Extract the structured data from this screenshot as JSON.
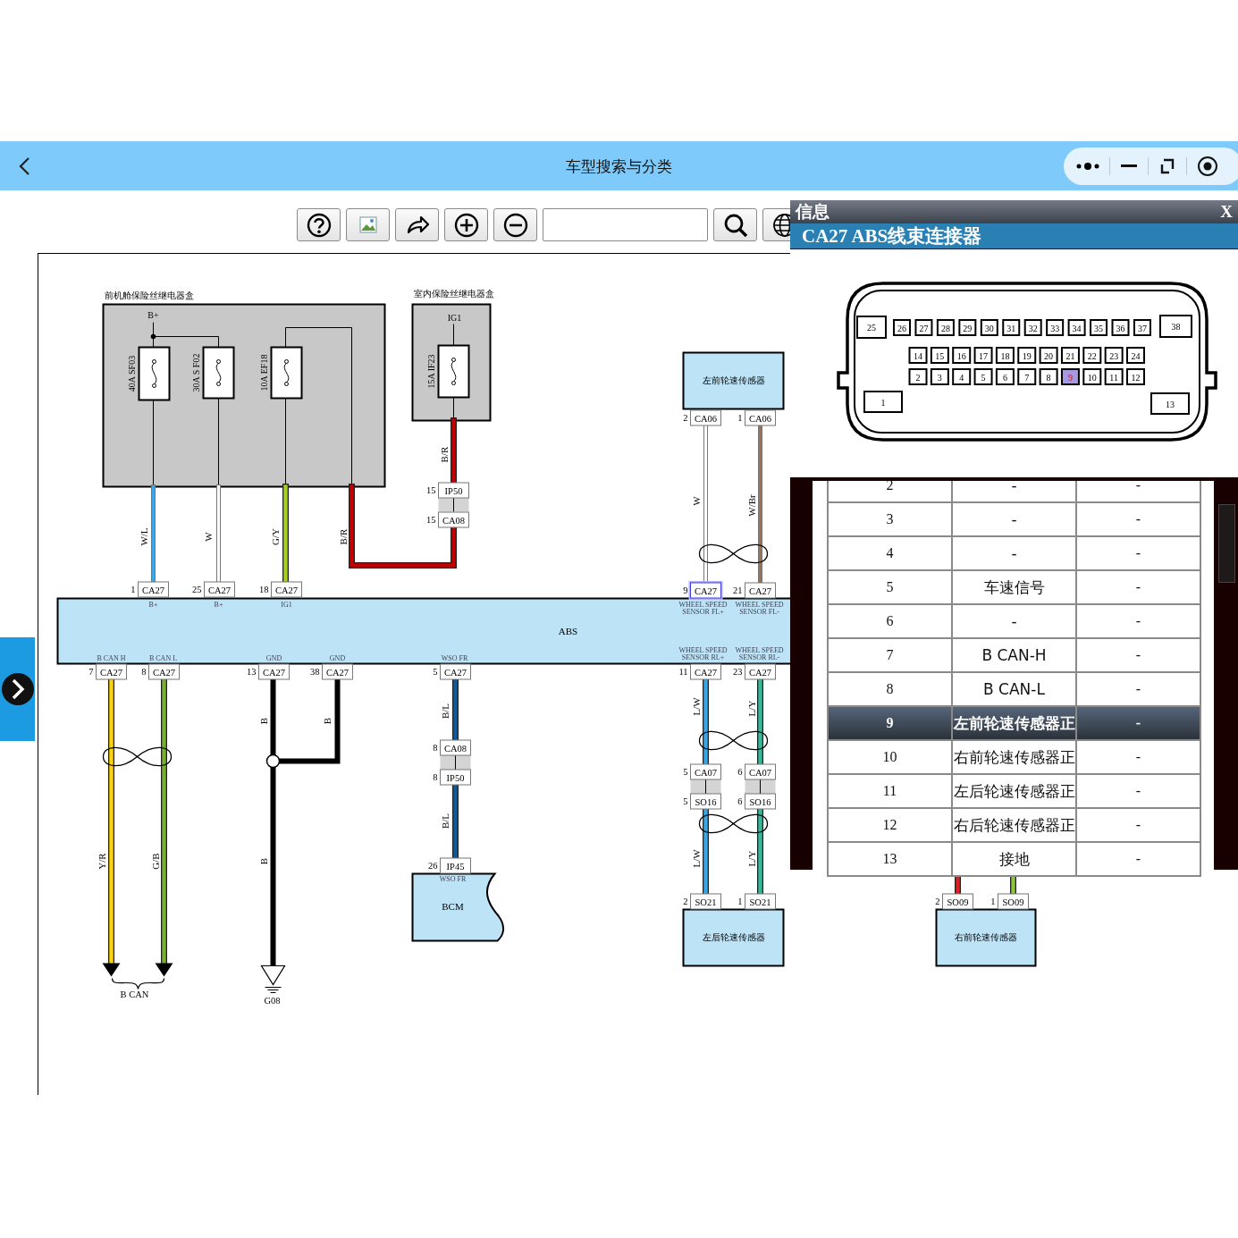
{
  "header": {
    "title": "车型搜索与分类"
  },
  "toolbar": {
    "items": [
      {
        "kind": "help"
      },
      {
        "kind": "image"
      },
      {
        "kind": "redo"
      },
      {
        "kind": "zoom_in"
      },
      {
        "kind": "zoom_out"
      },
      {
        "kind": "search_field"
      },
      {
        "kind": "search"
      },
      {
        "kind": "globe"
      }
    ]
  },
  "diagram": {
    "fuse_boxes": [
      {
        "title": "前机舱保险丝继电器盒",
        "supply": "B+",
        "fuses": [
          {
            "label": "40A  SF03"
          },
          {
            "label": "30A  S F02"
          },
          {
            "label": "10A  EF18"
          }
        ]
      },
      {
        "title": "室内保险丝继电器盒",
        "supply": "IG1",
        "fuses": [
          {
            "label": "15A  IF23"
          }
        ]
      }
    ],
    "modules": [
      {
        "kind": "ecu",
        "name": "ABS"
      },
      {
        "kind": "sensor",
        "name": "左前轮速传感器"
      },
      {
        "kind": "sensor",
        "name": "左后轮速传感器"
      },
      {
        "kind": "sensor",
        "name": "右前轮速传感器"
      },
      {
        "kind": "bcm",
        "name": "BCM"
      }
    ],
    "pin_functions": [
      "B+",
      "B+",
      "IG1",
      "WHEEL SPEED SENSOR FL+",
      "WHEEL SPEED SENSOR FL-",
      "B CAN H",
      "B CAN L",
      "GND",
      "GND",
      "WSO FR",
      "WHEEL SPEED SENSOR RL+",
      "WHEEL SPEED SENSOR RL-",
      "WSO FR"
    ],
    "connectors": [
      {
        "pin": "1",
        "name": "CA27",
        "selected": false
      },
      {
        "pin": "25",
        "name": "CA27",
        "selected": false
      },
      {
        "pin": "18",
        "name": "CA27",
        "selected": false
      },
      {
        "pin": "15",
        "name": "IP50",
        "selected": false
      },
      {
        "pin": "15",
        "name": "CA08",
        "selected": false
      },
      {
        "pin": "2",
        "name": "CA06",
        "selected": false
      },
      {
        "pin": "1",
        "name": "CA06",
        "selected": false
      },
      {
        "pin": "9",
        "name": "CA27",
        "selected": true
      },
      {
        "pin": "21",
        "name": "CA27",
        "selected": false
      },
      {
        "pin": "7",
        "name": "CA27",
        "selected": false
      },
      {
        "pin": "8",
        "name": "CA27",
        "selected": false
      },
      {
        "pin": "13",
        "name": "CA27",
        "selected": false
      },
      {
        "pin": "38",
        "name": "CA27",
        "selected": false
      },
      {
        "pin": "5",
        "name": "CA27",
        "selected": false
      },
      {
        "pin": "11",
        "name": "CA27",
        "selected": false
      },
      {
        "pin": "23",
        "name": "CA27",
        "selected": false
      },
      {
        "pin": "8",
        "name": "CA08",
        "selected": false
      },
      {
        "pin": "8",
        "name": "IP50",
        "selected": false
      },
      {
        "pin": "5",
        "name": "CA07",
        "selected": false
      },
      {
        "pin": "6",
        "name": "CA07",
        "selected": false
      },
      {
        "pin": "5",
        "name": "SO16",
        "selected": false
      },
      {
        "pin": "6",
        "name": "SO16",
        "selected": false
      },
      {
        "pin": "26",
        "name": "IP45",
        "selected": false
      },
      {
        "pin": "2",
        "name": "SO21",
        "selected": false
      },
      {
        "pin": "1",
        "name": "SO21",
        "selected": false
      },
      {
        "pin": "2",
        "name": "SO09",
        "selected": false
      },
      {
        "pin": "1",
        "name": "SO09",
        "selected": false
      }
    ],
    "wires": [
      {
        "labels": [
          "W/L"
        ],
        "color": "#3fa6e6"
      },
      {
        "labels": [
          "W"
        ],
        "color": "#ffffff"
      },
      {
        "labels": [
          "G/Y"
        ],
        "color": "#a6d21e"
      },
      {
        "labels": [
          "B/R",
          "B/R"
        ],
        "color": "#c40000"
      },
      {
        "labels": [
          "W"
        ],
        "color": "#ffffff"
      },
      {
        "labels": [
          "W/Br"
        ],
        "color": "#9a7258"
      },
      {
        "labels": [
          "Y/R"
        ],
        "color": "#ffd400"
      },
      {
        "labels": [
          "G/B"
        ],
        "color": "#78b02e"
      },
      {
        "labels": [
          "B",
          "B",
          "B"
        ],
        "color": "#000000"
      },
      {
        "labels": [
          "B/L",
          "B/L"
        ],
        "color": "#0e5a9a"
      },
      {
        "labels": [
          "L/W",
          "L/W"
        ],
        "color": "#36a8ea"
      },
      {
        "labels": [
          "L/Y",
          "L/Y"
        ],
        "color": "#38b89a"
      },
      {
        "color": "#e02020"
      },
      {
        "color": "#8cc43a"
      }
    ],
    "ground": {
      "name": "G08"
    },
    "bus": {
      "name": "B CAN"
    }
  },
  "popup": {
    "window_title": "信息",
    "close": "X",
    "heading": "CA27 ABS线束连接器",
    "connector": {
      "rows": [
        {
          "pins": [
            {
              "label": "25",
              "selected": false
            },
            {
              "label": "26",
              "selected": false
            },
            {
              "label": "27",
              "selected": false
            },
            {
              "label": "28",
              "selected": false
            },
            {
              "label": "29",
              "selected": false
            },
            {
              "label": "30",
              "selected": false
            },
            {
              "label": "31",
              "selected": false
            },
            {
              "label": "32",
              "selected": false
            },
            {
              "label": "33",
              "selected": false
            },
            {
              "label": "34",
              "selected": false
            },
            {
              "label": "35",
              "selected": false
            },
            {
              "label": "36",
              "selected": false
            },
            {
              "label": "37",
              "selected": false
            },
            {
              "label": "38",
              "selected": false
            }
          ]
        },
        {
          "pins": [
            {
              "label": "14",
              "selected": false
            },
            {
              "label": "15",
              "selected": false
            },
            {
              "label": "16",
              "selected": false
            },
            {
              "label": "17",
              "selected": false
            },
            {
              "label": "18",
              "selected": false
            },
            {
              "label": "19",
              "selected": false
            },
            {
              "label": "20",
              "selected": false
            },
            {
              "label": "21",
              "selected": false
            },
            {
              "label": "22",
              "selected": false
            },
            {
              "label": "23",
              "selected": false
            },
            {
              "label": "24",
              "selected": false
            }
          ]
        },
        {
          "pins": [
            {
              "label": "2",
              "selected": false
            },
            {
              "label": "3",
              "selected": false
            },
            {
              "label": "4",
              "selected": false
            },
            {
              "label": "5",
              "selected": false
            },
            {
              "label": "6",
              "selected": false
            },
            {
              "label": "7",
              "selected": false
            },
            {
              "label": "8",
              "selected": false
            },
            {
              "label": "9",
              "selected": true
            },
            {
              "label": "10",
              "selected": false
            },
            {
              "label": "11",
              "selected": false
            },
            {
              "label": "12",
              "selected": false
            }
          ]
        },
        {
          "pins": [
            {
              "label": "1",
              "selected": false
            },
            {
              "label": "13",
              "selected": false
            }
          ]
        }
      ]
    },
    "table": {
      "rows": [
        {
          "pin": "2",
          "function": "-",
          "column_3": "-",
          "selected": false
        },
        {
          "pin": "3",
          "function": "-",
          "column_3": "-",
          "selected": false
        },
        {
          "pin": "4",
          "function": "-",
          "column_3": "-",
          "selected": false
        },
        {
          "pin": "5",
          "function": "车速信号",
          "column_3": "-",
          "selected": false
        },
        {
          "pin": "6",
          "function": "-",
          "column_3": "-",
          "selected": false
        },
        {
          "pin": "7",
          "function": "B CAN-H",
          "column_3": "-",
          "selected": false
        },
        {
          "pin": "8",
          "function": "B CAN-L",
          "column_3": "-",
          "selected": false
        },
        {
          "pin": "9",
          "function": "左前轮速传感器正",
          "column_3": "-",
          "selected": true
        },
        {
          "pin": "10",
          "function": "右前轮速传感器正",
          "column_3": "-",
          "selected": false
        },
        {
          "pin": "11",
          "function": "左后轮速传感器正",
          "column_3": "-",
          "selected": false
        },
        {
          "pin": "12",
          "function": "右后轮速传感器正",
          "column_3": "-",
          "selected": false
        },
        {
          "pin": "13",
          "function": "接地",
          "column_3": "-",
          "selected": false
        }
      ]
    }
  }
}
